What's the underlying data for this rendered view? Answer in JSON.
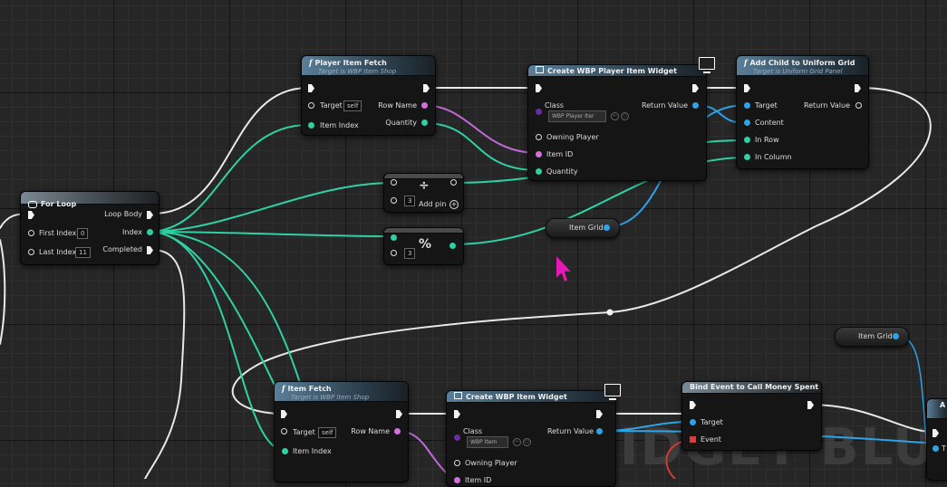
{
  "watermark": "WIDGET BLU",
  "nodes": {
    "for_loop": {
      "title": "For Loop",
      "pins": {
        "first_index": "First Index",
        "last_index": "Last Index",
        "loop_body": "Loop Body",
        "index": "Index",
        "completed": "Completed"
      },
      "values": {
        "first_index": "0",
        "last_index": "11"
      }
    },
    "player_item_fetch": {
      "title": "Player Item Fetch",
      "subtitle": "Target is WBP Item Shop",
      "pins": {
        "target": "Target",
        "item_index": "Item Index",
        "row_name": "Row Name",
        "quantity": "Quantity"
      },
      "values": {
        "target": "self"
      }
    },
    "create_wbp_player_item_widget": {
      "title": "Create WBP Player Item Widget",
      "pins": {
        "class": "Class",
        "owning_player": "Owning Player",
        "item_id": "Item ID",
        "quantity": "Quantity",
        "return_value": "Return Value"
      },
      "values": {
        "class": "WBP Player Iter"
      }
    },
    "add_child_to_uniform_grid": {
      "title": "Add Child to Uniform Grid",
      "subtitle": "Target is Uniform Grid Panel",
      "pins": {
        "target": "Target",
        "content": "Content",
        "in_row": "In Row",
        "in_column": "In Column",
        "return_value": "Return Value"
      }
    },
    "divide": {
      "symbol": "÷",
      "value": "3",
      "add_pin": "Add pin"
    },
    "modulo": {
      "symbol": "%",
      "value": "3"
    },
    "item_grid_1": {
      "label": "Item Grid"
    },
    "item_grid_2": {
      "label": "Item Grid"
    },
    "item_fetch": {
      "title": "Item Fetch",
      "subtitle": "Target is WBP Item Shop",
      "pins": {
        "target": "Target",
        "item_index": "Item Index",
        "row_name": "Row Name"
      },
      "values": {
        "target": "self"
      }
    },
    "create_wbp_item_widget": {
      "title": "Create WBP Item Widget",
      "pins": {
        "class": "Class",
        "owning_player": "Owning Player",
        "item_id": "Item ID",
        "return_value": "Return Value"
      },
      "values": {
        "class": "WBP Item"
      }
    },
    "bind_event": {
      "title": "Bind Event to Call Money Spent",
      "pins": {
        "target": "Target",
        "event": "Event"
      }
    },
    "partial_node": {
      "title": "A",
      "pins": {
        "t": "T"
      }
    }
  },
  "colors": {
    "exec": "#f2f2f2",
    "integer": "#2fd1a3",
    "name": "#d56fe0",
    "object": "#2ea3e8",
    "class": "#6a2ca3",
    "delegate": "#e03a3a",
    "cursor": "#e418b2"
  },
  "icons": [
    "function-icon",
    "loop-icon",
    "screen-icon",
    "cursor-icon"
  ]
}
